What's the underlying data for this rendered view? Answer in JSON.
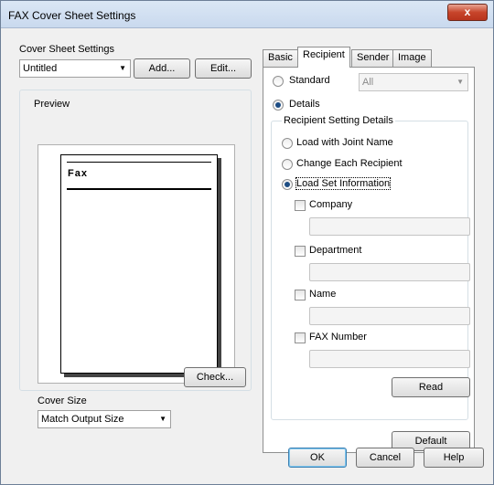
{
  "window": {
    "title": "FAX Cover Sheet Settings",
    "close_glyph": "x"
  },
  "left": {
    "cover_sheet_settings_label": "Cover Sheet Settings",
    "cover_sheet_select_value": "Untitled",
    "add_button": "Add...",
    "edit_button": "Edit...",
    "preview_label": "Preview",
    "preview_paper_heading": "Fax",
    "check_button": "Check...",
    "cover_size_label": "Cover Size",
    "cover_size_select_value": "Match Output Size"
  },
  "tabs": [
    "Basic",
    "Recipient",
    "Sender",
    "Image"
  ],
  "active_tab": "Recipient",
  "recipient": {
    "standard_label": "Standard",
    "standard_select_value": "All",
    "details_label": "Details",
    "group_label": "Recipient Setting Details",
    "options": {
      "joint_name": "Load with Joint Name",
      "change_each": "Change Each Recipient",
      "load_set": "Load Set Information"
    },
    "fields": {
      "company": "Company",
      "department": "Department",
      "name": "Name",
      "fax_number": "FAX Number"
    },
    "read_button": "Read",
    "default_button": "Default"
  },
  "footer": {
    "ok": "OK",
    "cancel": "Cancel",
    "help": "Help"
  },
  "icons": {
    "dropdown": "chevron-down-icon",
    "close": "close-icon"
  }
}
